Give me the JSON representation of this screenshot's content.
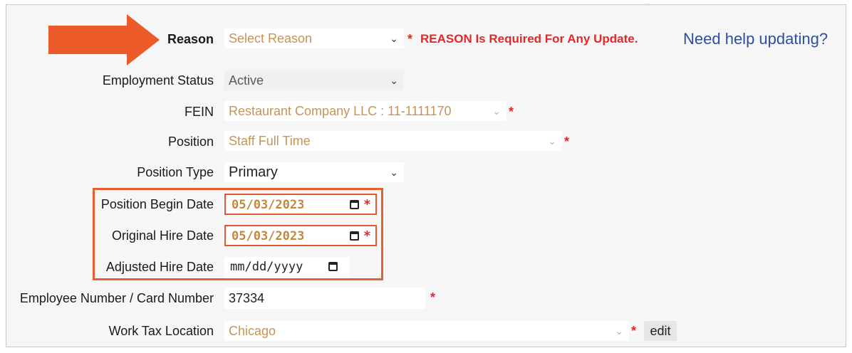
{
  "form": {
    "reason": {
      "label": "Reason",
      "value": "Select Reason",
      "required_marker": "*",
      "required_message": "REASON Is Required For Any Update.",
      "help_link": "Need help updating?"
    },
    "employment_status": {
      "label": "Employment Status",
      "value": "Active"
    },
    "fein": {
      "label": "FEIN",
      "value": "Restaurant Company LLC : 11-1111170",
      "required_marker": "*"
    },
    "position": {
      "label": "Position",
      "value": "Staff Full Time",
      "required_marker": "*"
    },
    "position_type": {
      "label": "Position Type",
      "value": "Primary"
    },
    "position_begin_date": {
      "label": "Position Begin Date",
      "value": "05/03/2023",
      "required_marker": "*"
    },
    "original_hire_date": {
      "label": "Original Hire Date",
      "value": "05/03/2023",
      "required_marker": "*"
    },
    "adjusted_hire_date": {
      "label": "Adjusted Hire Date",
      "placeholder": "mm/dd/yyyy"
    },
    "employee_number": {
      "label": "Employee Number / Card Number",
      "value": "37334",
      "required_marker": "*"
    },
    "work_tax_location": {
      "label": "Work Tax Location",
      "value": "Chicago",
      "required_marker": "*",
      "edit_label": "edit"
    }
  },
  "colors": {
    "arrow": "#ec5a2a",
    "highlight_border": "#e4602f",
    "required": "#e02a2a",
    "link": "#2c4fa3",
    "selected_value": "#c59458"
  },
  "icons": {
    "dropdown": "chevron-down-icon",
    "date": "calendar-icon",
    "pointer": "arrow-right-icon"
  }
}
